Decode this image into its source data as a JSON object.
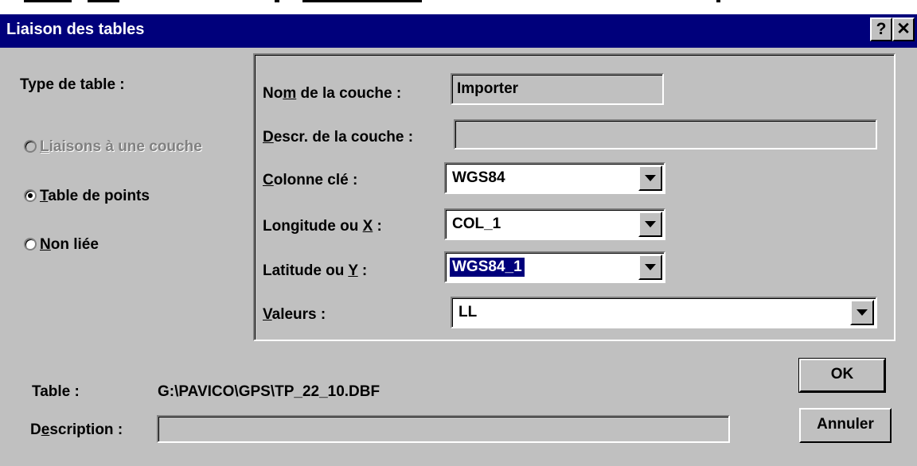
{
  "window": {
    "title": "Liaison des tables",
    "help_button": "?",
    "close_button": "✕"
  },
  "type_table": {
    "label": "Type de table :",
    "options": [
      {
        "label": "Liaisons à une couche",
        "mnemonic": "L",
        "rest": "iaisons à une couche",
        "selected": false,
        "enabled": false
      },
      {
        "label": "Table de points",
        "mnemonic": "T",
        "rest": "able de points",
        "selected": true,
        "enabled": true
      },
      {
        "label": "Non liée",
        "mnemonic": "N",
        "rest": "on liée",
        "selected": false,
        "enabled": true
      }
    ]
  },
  "form": {
    "nom_couche": {
      "label_pre": "No",
      "label_mn": "m",
      "label_post": " de la couche :",
      "value": "Importer"
    },
    "descr_couche": {
      "label_pre": "",
      "label_mn": "D",
      "label_post": "escr. de la couche :",
      "value": ""
    },
    "colonne_cle": {
      "label_pre": "",
      "label_mn": "C",
      "label_post": "olonne clé :",
      "value": "WGS84"
    },
    "longitude": {
      "label_pre": "Longitude ou ",
      "label_mn": "X",
      "label_post": " :",
      "value": "COL_1"
    },
    "latitude": {
      "label_pre": "Latitude ou ",
      "label_mn": "Y",
      "label_post": " :",
      "value": "WGS84_1"
    },
    "valeurs": {
      "label_pre": "",
      "label_mn": "V",
      "label_post": "aleurs :",
      "value": "LL"
    }
  },
  "table": {
    "label": "Table :",
    "path": "G:\\PAVICO\\GPS\\TP_22_10.DBF"
  },
  "description": {
    "label_pre": "D",
    "label_mn": "e",
    "label_post": "scription :",
    "value": ""
  },
  "buttons": {
    "ok": "OK",
    "cancel": "Annuler"
  }
}
